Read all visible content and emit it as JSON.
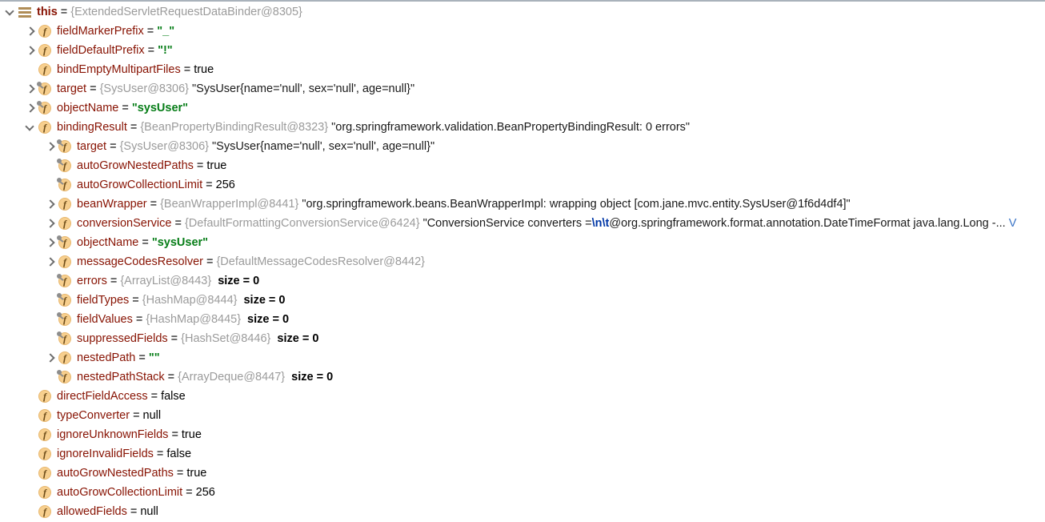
{
  "panel": {
    "name": "debugger-variables-panel",
    "colors": {
      "field_name": "#871202",
      "type_ref": "#9b9b9b",
      "string_literal": "#067d17",
      "escape_seq": "#0037a6",
      "icon_fill": "#f7cf8e",
      "icon_letter": "#6b4a17",
      "this_icon": "#b08d57",
      "chevron": "#6e6e6e",
      "link": "#3a74c6",
      "background": "#ffffff"
    }
  },
  "rows": [
    {
      "id": "this",
      "indent": 0,
      "expander": "expanded",
      "icon": "this-bars-icon",
      "name": "this",
      "eq": "=",
      "ref": "{ExtendedServletRequestDataBinder@8305}"
    },
    {
      "id": "fieldMarkerPrefix",
      "indent": 1,
      "expander": "collapsed",
      "icon": "field-icon",
      "name": "fieldMarkerPrefix",
      "eq": "=",
      "str": "\"_\""
    },
    {
      "id": "fieldDefaultPrefix",
      "indent": 1,
      "expander": "collapsed",
      "icon": "field-icon",
      "name": "fieldDefaultPrefix",
      "eq": "=",
      "str": "\"!\""
    },
    {
      "id": "bindEmptyMultipartFiles",
      "indent": 1,
      "expander": "none",
      "icon": "field-icon",
      "name": "bindEmptyMultipartFiles",
      "eq": "=",
      "val": "true"
    },
    {
      "id": "target",
      "indent": 1,
      "expander": "collapsed",
      "icon": "field-icon-final",
      "name": "target",
      "eq": "=",
      "ref": "{SysUser@8306}",
      "tostr": "\"SysUser{name='null', sex='null', age=null}\""
    },
    {
      "id": "objectName",
      "indent": 1,
      "expander": "collapsed",
      "icon": "field-icon-final",
      "name": "objectName",
      "eq": "=",
      "str": "\"sysUser\""
    },
    {
      "id": "bindingResult",
      "indent": 1,
      "expander": "expanded",
      "icon": "field-icon",
      "name": "bindingResult",
      "eq": "=",
      "ref": "{BeanPropertyBindingResult@8323}",
      "tostr": "\"org.springframework.validation.BeanPropertyBindingResult: 0 errors\""
    },
    {
      "id": "bindingResult.target",
      "indent": 2,
      "expander": "collapsed",
      "icon": "field-icon-final",
      "name": "target",
      "eq": "=",
      "ref": "{SysUser@8306}",
      "tostr": "\"SysUser{name='null', sex='null', age=null}\""
    },
    {
      "id": "bindingResult.autoGrowNestedPaths",
      "indent": 2,
      "expander": "none",
      "icon": "field-icon-final",
      "name": "autoGrowNestedPaths",
      "eq": "=",
      "val": "true"
    },
    {
      "id": "bindingResult.autoGrowCollectionLimit",
      "indent": 2,
      "expander": "none",
      "icon": "field-icon-final",
      "name": "autoGrowCollectionLimit",
      "eq": "=",
      "val": "256"
    },
    {
      "id": "bindingResult.beanWrapper",
      "indent": 2,
      "expander": "collapsed",
      "icon": "field-icon",
      "name": "beanWrapper",
      "eq": "=",
      "ref": "{BeanWrapperImpl@8441}",
      "tostr": "\"org.springframework.beans.BeanWrapperImpl: wrapping object [com.jane.mvc.entity.SysUser@1f6d4df4]\""
    },
    {
      "id": "bindingResult.conversionService",
      "indent": 2,
      "expander": "collapsed",
      "icon": "field-icon",
      "name": "conversionService",
      "eq": "=",
      "ref": "{DefaultFormattingConversionService@6424}",
      "tostr_pre": "\"ConversionService converters =",
      "escape": "\\n\\t",
      "tostr_post": "@org.springframework.format.annotation.DateTimeFormat java.lang.Long -...",
      "link": "V"
    },
    {
      "id": "bindingResult.objectName",
      "indent": 2,
      "expander": "collapsed",
      "icon": "field-icon-final",
      "name": "objectName",
      "eq": "=",
      "str": "\"sysUser\""
    },
    {
      "id": "bindingResult.messageCodesResolver",
      "indent": 2,
      "expander": "collapsed",
      "icon": "field-icon",
      "name": "messageCodesResolver",
      "eq": "=",
      "ref": "{DefaultMessageCodesResolver@8442}"
    },
    {
      "id": "bindingResult.errors",
      "indent": 2,
      "expander": "none",
      "icon": "field-icon-final",
      "name": "errors",
      "eq": "=",
      "ref": "{ArrayList@8443}",
      "size": "size = 0"
    },
    {
      "id": "bindingResult.fieldTypes",
      "indent": 2,
      "expander": "none",
      "icon": "field-icon-final",
      "name": "fieldTypes",
      "eq": "=",
      "ref": "{HashMap@8444}",
      "size": "size = 0"
    },
    {
      "id": "bindingResult.fieldValues",
      "indent": 2,
      "expander": "none",
      "icon": "field-icon-final",
      "name": "fieldValues",
      "eq": "=",
      "ref": "{HashMap@8445}",
      "size": "size = 0"
    },
    {
      "id": "bindingResult.suppressedFields",
      "indent": 2,
      "expander": "none",
      "icon": "field-icon-final",
      "name": "suppressedFields",
      "eq": "=",
      "ref": "{HashSet@8446}",
      "size": "size = 0"
    },
    {
      "id": "bindingResult.nestedPath",
      "indent": 2,
      "expander": "collapsed",
      "icon": "field-icon",
      "name": "nestedPath",
      "eq": "=",
      "str": "\"\""
    },
    {
      "id": "bindingResult.nestedPathStack",
      "indent": 2,
      "expander": "none",
      "icon": "field-icon-final",
      "name": "nestedPathStack",
      "eq": "=",
      "ref": "{ArrayDeque@8447}",
      "size": "size = 0"
    },
    {
      "id": "directFieldAccess",
      "indent": 1,
      "expander": "none",
      "icon": "field-icon",
      "name": "directFieldAccess",
      "eq": "=",
      "val": "false"
    },
    {
      "id": "typeConverter",
      "indent": 1,
      "expander": "none",
      "icon": "field-icon",
      "name": "typeConverter",
      "eq": "=",
      "val": "null"
    },
    {
      "id": "ignoreUnknownFields",
      "indent": 1,
      "expander": "none",
      "icon": "field-icon",
      "name": "ignoreUnknownFields",
      "eq": "=",
      "val": "true"
    },
    {
      "id": "ignoreInvalidFields",
      "indent": 1,
      "expander": "none",
      "icon": "field-icon",
      "name": "ignoreInvalidFields",
      "eq": "=",
      "val": "false"
    },
    {
      "id": "autoGrowNestedPaths",
      "indent": 1,
      "expander": "none",
      "icon": "field-icon",
      "name": "autoGrowNestedPaths",
      "eq": "=",
      "val": "true"
    },
    {
      "id": "autoGrowCollectionLimit",
      "indent": 1,
      "expander": "none",
      "icon": "field-icon",
      "name": "autoGrowCollectionLimit",
      "eq": "=",
      "val": "256"
    },
    {
      "id": "allowedFields",
      "indent": 1,
      "expander": "none",
      "icon": "field-icon",
      "name": "allowedFields",
      "eq": "=",
      "val": "null"
    }
  ]
}
